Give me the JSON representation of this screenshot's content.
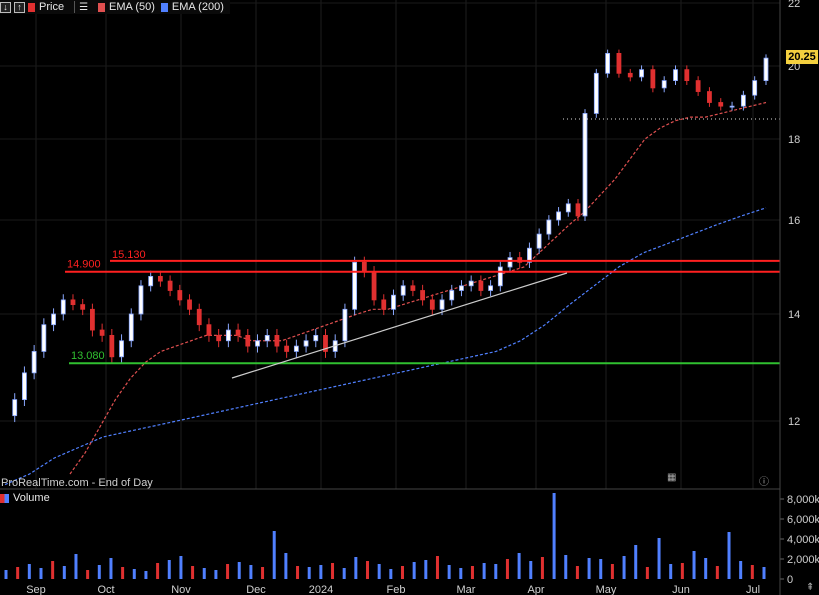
{
  "legend": {
    "price_label": "Price",
    "ema50_label": "EMA (50)",
    "ema200_label": "EMA (200)",
    "price_color": "#e03030",
    "ema50_color": "#e05050",
    "ema200_color": "#5080ff"
  },
  "watermark": "ProRealTime.com - End of Day",
  "volume_label": "Volume",
  "last_price": "20.25",
  "chart_data": {
    "type": "candlestick",
    "x_months": [
      "Sep",
      "Oct",
      "Nov",
      "Dec",
      "2024",
      "Feb",
      "Mar",
      "Apr",
      "May",
      "Jun",
      "Jul"
    ],
    "y_ticks": [
      "22",
      "20",
      "18",
      "16",
      "14",
      "12"
    ],
    "volume_ticks": [
      "8,000k",
      "6,000k",
      "4,000k",
      "2,000k",
      "0"
    ],
    "levels": [
      {
        "label": "15.130",
        "value": 15.13,
        "color": "#ff2020"
      },
      {
        "label": "14.900",
        "value": 14.9,
        "color": "#ff2020"
      },
      {
        "label": "13.080",
        "value": 13.08,
        "color": "#30c030"
      }
    ],
    "close_series": [
      12.1,
      12.4,
      12.9,
      13.3,
      13.8,
      14.0,
      14.3,
      14.2,
      14.1,
      13.7,
      13.6,
      13.2,
      13.5,
      14.0,
      14.6,
      14.8,
      14.7,
      14.5,
      14.3,
      14.1,
      13.8,
      13.6,
      13.5,
      13.7,
      13.6,
      13.4,
      13.5,
      13.6,
      13.4,
      13.3,
      13.4,
      13.5,
      13.6,
      13.3,
      13.5,
      14.1,
      15.1,
      14.9,
      14.3,
      14.1,
      14.4,
      14.6,
      14.5,
      14.3,
      14.1,
      14.3,
      14.5,
      14.6,
      14.7,
      14.5,
      14.6,
      15.0,
      15.2,
      15.1,
      15.4,
      15.7,
      16.0,
      16.2,
      16.4,
      16.1,
      18.7,
      19.8,
      20.4,
      19.8,
      19.7,
      19.9,
      19.4,
      19.6,
      19.9,
      19.6,
      19.3,
      19.0,
      18.9,
      18.9,
      19.2,
      19.6,
      20.25
    ],
    "ema50": [
      11.0,
      11.4,
      11.9,
      12.4,
      12.8,
      13.1,
      13.3,
      13.4,
      13.5,
      13.6,
      13.6,
      13.6,
      13.5,
      13.5,
      13.5,
      13.6,
      13.7,
      13.8,
      13.9,
      14.0,
      14.1,
      14.1,
      14.2,
      14.3,
      14.4,
      14.5,
      14.6,
      14.7,
      14.8,
      14.9,
      15.0,
      15.3,
      15.6,
      15.9,
      16.2,
      16.6,
      17.0,
      17.5,
      18.0,
      18.3,
      18.5,
      18.6,
      18.6,
      18.7,
      18.8,
      18.9,
      19.0
    ],
    "ema200": [
      10.8,
      11.0,
      11.3,
      11.5,
      11.7,
      11.8,
      11.9,
      12.0,
      12.1,
      12.2,
      12.3,
      12.4,
      12.5,
      12.6,
      12.7,
      12.8,
      12.9,
      13.0,
      13.1,
      13.2,
      13.3,
      13.5,
      13.8,
      14.2,
      14.6,
      15.0,
      15.3,
      15.5,
      15.7,
      15.9,
      16.1,
      16.3
    ],
    "volume": [
      900,
      1200,
      1500,
      1100,
      1800,
      1300,
      2500,
      900,
      1400,
      2100,
      1200,
      1000,
      800,
      1600,
      1900,
      2300,
      1300,
      1100,
      900,
      1500,
      1700,
      1400,
      1200,
      4800,
      2600,
      1300,
      1200,
      1400,
      1600,
      1100,
      2200,
      1800,
      1500,
      1000,
      1300,
      1700,
      1900,
      2300,
      1400,
      1100,
      1300,
      1600,
      1500,
      2000,
      2600,
      1800,
      2200,
      8600,
      2400,
      1300,
      2100,
      2000,
      1500,
      2300,
      3400,
      1200,
      4100,
      1500,
      1600,
      2800,
      2100,
      1300,
      4700,
      1800,
      1400,
      1200
    ]
  }
}
